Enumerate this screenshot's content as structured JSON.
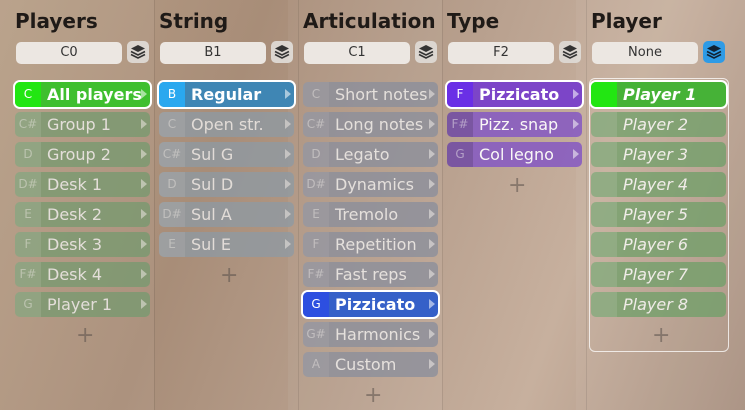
{
  "columns": [
    {
      "title": "Players",
      "key_field": "C0",
      "layer_active": false,
      "items": [
        {
          "key": "C",
          "label": "All players",
          "selected": true
        },
        {
          "key": "C#",
          "label": "Group 1",
          "selected": false
        },
        {
          "key": "D",
          "label": "Group 2",
          "selected": false
        },
        {
          "key": "D#",
          "label": "Desk 1",
          "selected": false
        },
        {
          "key": "E",
          "label": "Desk 2",
          "selected": false
        },
        {
          "key": "F",
          "label": "Desk 3",
          "selected": false
        },
        {
          "key": "F#",
          "label": "Desk 4",
          "selected": false
        },
        {
          "key": "G",
          "label": "Player 1",
          "selected": false
        }
      ],
      "plus": "+"
    },
    {
      "title": "String",
      "key_field": "B1",
      "layer_active": false,
      "items": [
        {
          "key": "B",
          "label": "Regular",
          "selected": true
        },
        {
          "key": "C",
          "label": "Open str.",
          "selected": false
        },
        {
          "key": "C#",
          "label": "Sul G",
          "selected": false
        },
        {
          "key": "D",
          "label": "Sul D",
          "selected": false
        },
        {
          "key": "D#",
          "label": "Sul A",
          "selected": false
        },
        {
          "key": "E",
          "label": "Sul E",
          "selected": false
        }
      ],
      "plus": "+"
    },
    {
      "title": "Articulation",
      "key_field": "C1",
      "layer_active": false,
      "items": [
        {
          "key": "C",
          "label": "Short notes",
          "selected": false
        },
        {
          "key": "C#",
          "label": "Long notes",
          "selected": false
        },
        {
          "key": "D",
          "label": "Legato",
          "selected": false
        },
        {
          "key": "D#",
          "label": "Dynamics",
          "selected": false
        },
        {
          "key": "E",
          "label": "Tremolo",
          "selected": false
        },
        {
          "key": "F",
          "label": "Repetition",
          "selected": false
        },
        {
          "key": "F#",
          "label": "Fast reps",
          "selected": false
        },
        {
          "key": "G",
          "label": "Pizzicato",
          "selected": true
        },
        {
          "key": "G#",
          "label": "Harmonics",
          "selected": false
        },
        {
          "key": "A",
          "label": "Custom",
          "selected": false
        }
      ],
      "plus": "+"
    },
    {
      "title": "Type",
      "key_field": "F2",
      "layer_active": false,
      "items": [
        {
          "key": "F",
          "label": "Pizzicato",
          "selected": true
        },
        {
          "key": "F#",
          "label": "Pizz. snap",
          "selected": false
        },
        {
          "key": "G",
          "label": "Col legno",
          "selected": false
        }
      ],
      "plus": "+"
    },
    {
      "title": "Player",
      "key_field": "None",
      "layer_active": true,
      "items": [
        {
          "key": "",
          "label": "Player 1",
          "selected": true
        },
        {
          "key": "",
          "label": "Player 2",
          "selected": false
        },
        {
          "key": "",
          "label": "Player 3",
          "selected": false
        },
        {
          "key": "",
          "label": "Player 4",
          "selected": false
        },
        {
          "key": "",
          "label": "Player 5",
          "selected": false
        },
        {
          "key": "",
          "label": "Player 6",
          "selected": false
        },
        {
          "key": "",
          "label": "Player 7",
          "selected": false
        },
        {
          "key": "",
          "label": "Player 8",
          "selected": false
        }
      ],
      "plus": "+"
    }
  ],
  "colors": {
    "players_selected": "#3fbf2f",
    "players_selected_key": "#22e612",
    "players_item": "#789a70",
    "string_selected": "#3f86b4",
    "string_selected_key": "#2aa8ef",
    "string_item": "#8f9aa3",
    "articulation_selected": "#3560c8",
    "articulation_selected_key": "#2d4fe0",
    "articulation_item": "#8b8f9c",
    "type_selected": "#7c45c8",
    "type_selected_key": "#6a2fe6",
    "type_item": "#8a5fc0",
    "player_selected": "#46b237",
    "player_selected_key": "#22e612",
    "player_item": "#72a06a",
    "layer_button_active": "#2e9be6"
  },
  "icons": {
    "layer_button": "layers-icon",
    "item_arrow": "chevron-right-icon"
  }
}
